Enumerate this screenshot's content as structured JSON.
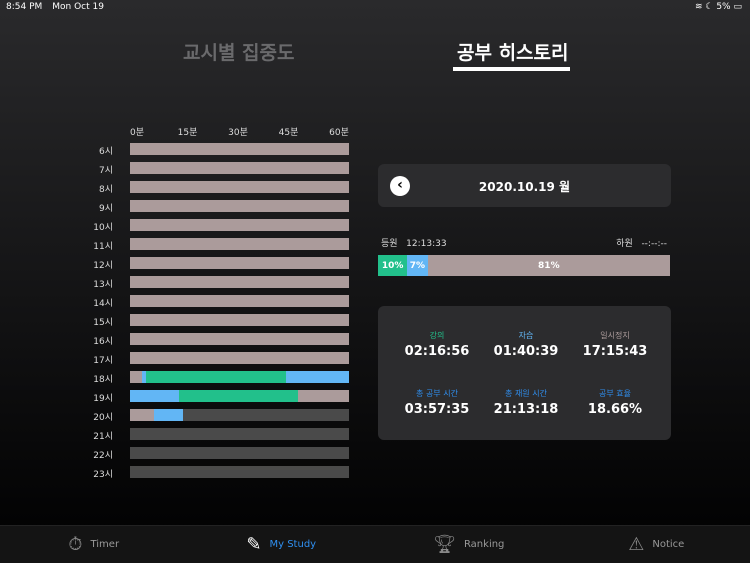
{
  "status": {
    "time": "8:54 PM",
    "date": "Mon Oct 19",
    "battery": "5%"
  },
  "tabs": [
    {
      "label": "교시별 집중도",
      "active": false
    },
    {
      "label": "공부 히스토리",
      "active": true
    }
  ],
  "chart_data": {
    "type": "bar",
    "x_ticks": [
      "0분",
      "15분",
      "30분",
      "45분",
      "60분"
    ],
    "xlim": [
      0,
      60
    ],
    "rows": [
      "6시",
      "7시",
      "8시",
      "9시",
      "10시",
      "11시",
      "12시",
      "13시",
      "14시",
      "15시",
      "16시",
      "17시",
      "18시",
      "19시",
      "20시",
      "21시",
      "22시",
      "23시"
    ],
    "colors": {
      "lecture": "#22c08b",
      "self_study": "#62b6f5",
      "pause": "#ab9b9b",
      "none": "#4a4a4a"
    },
    "segments": [
      [
        {
          "type": "pause",
          "start": 0,
          "end": 60
        }
      ],
      [
        {
          "type": "pause",
          "start": 0,
          "end": 60
        }
      ],
      [
        {
          "type": "pause",
          "start": 0,
          "end": 60
        }
      ],
      [
        {
          "type": "pause",
          "start": 0,
          "end": 60
        }
      ],
      [
        {
          "type": "pause",
          "start": 0,
          "end": 60
        }
      ],
      [
        {
          "type": "pause",
          "start": 0,
          "end": 60
        }
      ],
      [
        {
          "type": "pause",
          "start": 0,
          "end": 60
        }
      ],
      [
        {
          "type": "pause",
          "start": 0,
          "end": 60
        }
      ],
      [
        {
          "type": "pause",
          "start": 0,
          "end": 60
        }
      ],
      [
        {
          "type": "pause",
          "start": 0,
          "end": 60
        }
      ],
      [
        {
          "type": "pause",
          "start": 0,
          "end": 60
        }
      ],
      [
        {
          "type": "pause",
          "start": 0,
          "end": 60
        }
      ],
      [
        {
          "type": "pause",
          "start": 0,
          "end": 3.3
        },
        {
          "type": "self_study",
          "start": 3.3,
          "end": 4.3
        },
        {
          "type": "lecture",
          "start": 4.3,
          "end": 42.7
        },
        {
          "type": "self_study",
          "start": 42.7,
          "end": 60
        }
      ],
      [
        {
          "type": "self_study",
          "start": 0,
          "end": 13.4
        },
        {
          "type": "lecture",
          "start": 13.4,
          "end": 45.9
        },
        {
          "type": "pause",
          "start": 45.9,
          "end": 60
        }
      ],
      [
        {
          "type": "pause",
          "start": 0,
          "end": 6.6
        },
        {
          "type": "self_study",
          "start": 6.6,
          "end": 14.4
        }
      ],
      [],
      [],
      []
    ]
  },
  "history": {
    "date": "2020.10.19 월",
    "checkin_label": "등원",
    "checkin": "12:13:33",
    "checkout_label": "하원",
    "checkout": "--:--:--",
    "progress": [
      {
        "label": "10%",
        "value": 10,
        "color": "#22c08b"
      },
      {
        "label": "7%",
        "value": 7,
        "color": "#62b6f5"
      },
      {
        "label": "81%",
        "value": 81,
        "color": "#ab9b9b"
      }
    ],
    "stats": [
      {
        "label": "강의",
        "value": "02:16:56",
        "color": "#22c08b"
      },
      {
        "label": "자습",
        "value": "01:40:39",
        "color": "#62b6f5"
      },
      {
        "label": "일시정지",
        "value": "17:15:43",
        "color": "#ab9b9b"
      },
      {
        "label": "총 공부 시간",
        "value": "03:57:35",
        "color": "#2f8ff0"
      },
      {
        "label": "총 재원 시간",
        "value": "21:13:18",
        "color": "#2f8ff0"
      },
      {
        "label": "공부 효율",
        "value": "18.66%",
        "color": "#2f8ff0"
      }
    ]
  },
  "nav": [
    {
      "label": "Timer",
      "icon": "stopwatch-icon",
      "active": false
    },
    {
      "label": "My Study",
      "icon": "edit-icon",
      "active": true
    },
    {
      "label": "Ranking",
      "icon": "trophy-icon",
      "active": false
    },
    {
      "label": "Notice",
      "icon": "notice-icon",
      "active": false
    }
  ]
}
